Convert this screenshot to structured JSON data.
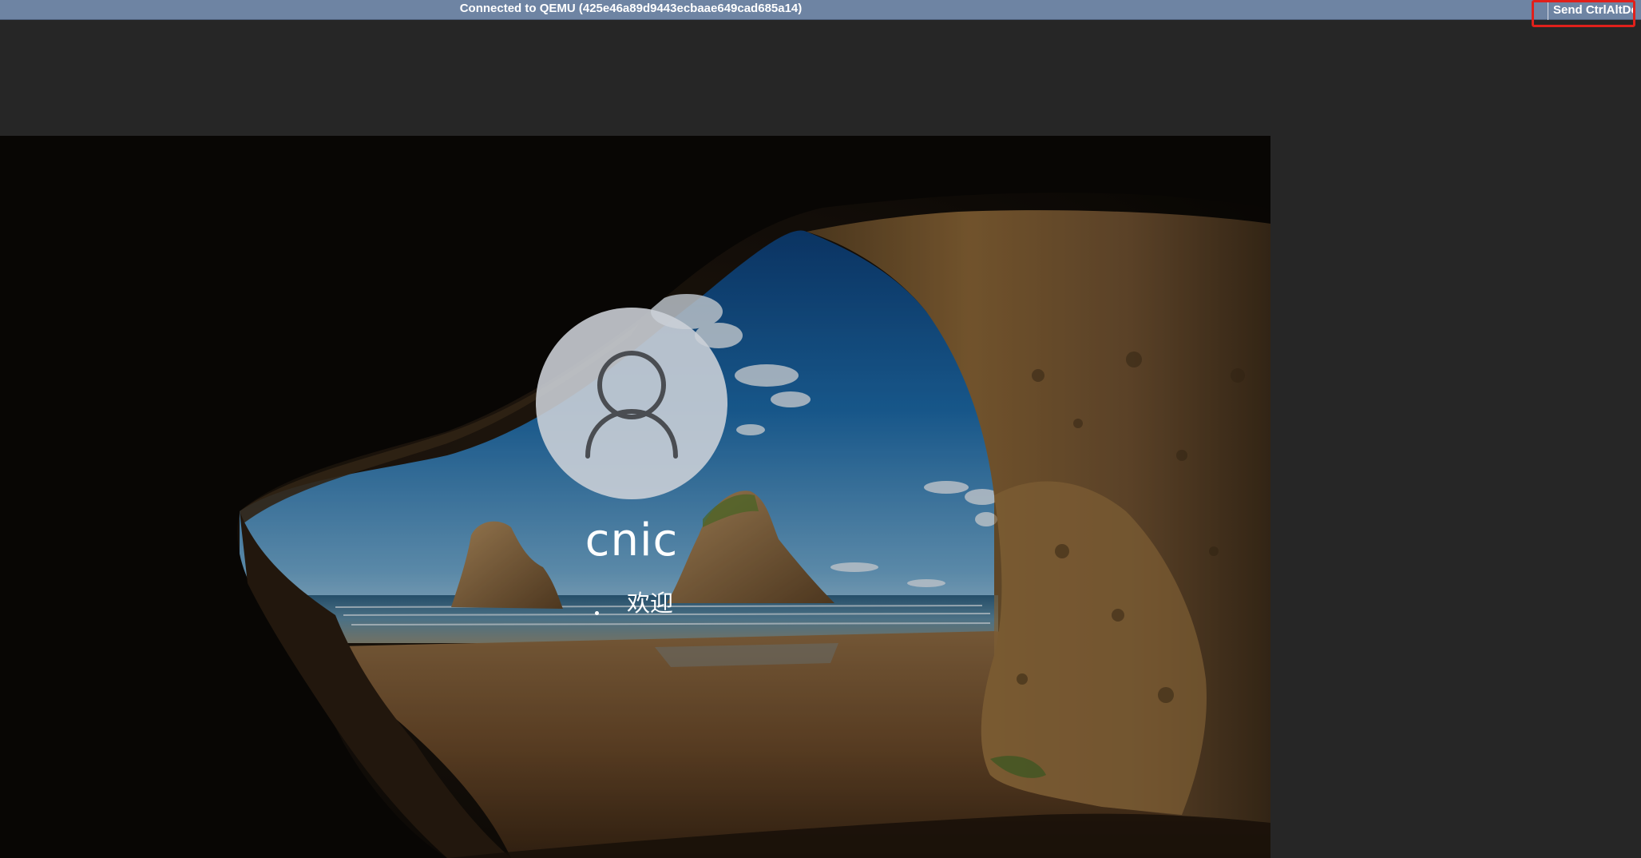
{
  "statusbar": {
    "connection_text": "Connected to QEMU (425e46a89d9443ecbaae649cad685a14)",
    "send_cad_label": "Send CtrlAltDel",
    "background_color": "#6e84a3",
    "highlight_color": "#e0201b"
  },
  "login": {
    "avatar_icon": "user-icon",
    "username": "cnic",
    "welcome_text": "欢迎",
    "spinner_icon": "loading-dot-icon"
  },
  "wallpaper": {
    "description_icon": "cave-beach-wallpaper"
  }
}
